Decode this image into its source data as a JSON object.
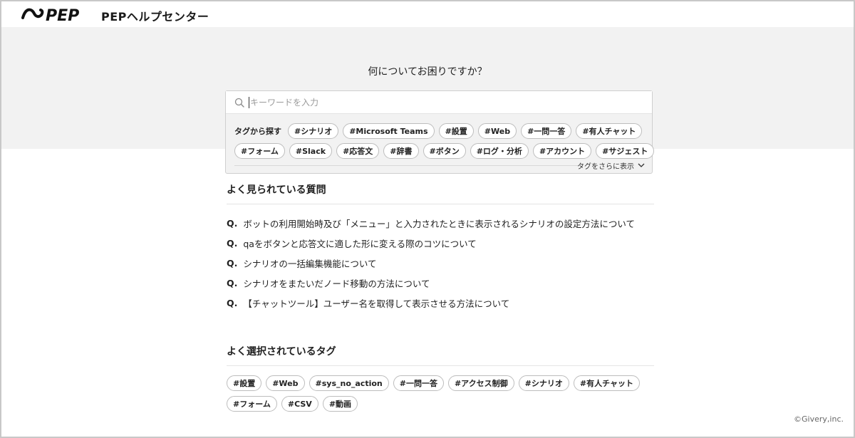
{
  "header": {
    "logo_text": "PEP",
    "brand": "PEPヘルプセンター"
  },
  "hero": {
    "title": "何についてお困りですか？"
  },
  "search": {
    "icon": "search-icon",
    "placeholder": "キーワードを入力",
    "value": ""
  },
  "tag_search": {
    "label": "タグから探す",
    "tags_row1": [
      "#シナリオ",
      "#Microsoft Teams",
      "#設置",
      "#Web",
      "#一問一答",
      "#有人チャット"
    ],
    "tags_row2": [
      "#フォーム",
      "#Slack",
      "#応答文",
      "#辞書",
      "#ボタン",
      "#ログ・分析",
      "#アカウント",
      "#サジェスト"
    ],
    "more_label": "タグをさらに表示",
    "more_icon": "chevron-down-icon"
  },
  "faq": {
    "title": "よく見られている質問",
    "q_prefix": "Q.",
    "items": [
      "ボットの利用開始時及び「メニュー」と入力されたときに表示されるシナリオの設定方法について",
      "qaをボタンと応答文に適した形に変える際のコツについて",
      "シナリオの一括編集機能について",
      "シナリオをまたいだノード移動の方法について",
      "【チャットツール】ユーザー名を取得して表示させる方法について"
    ]
  },
  "popular_tags": {
    "title": "よく選択されているタグ",
    "row1": [
      "#設置",
      "#Web",
      "#sys_no_action",
      "#一問一答",
      "#アクセス制御",
      "#シナリオ",
      "#有人チャット"
    ],
    "row2": [
      "#フォーム",
      "#CSV",
      "#動画"
    ]
  },
  "footer": {
    "copyright": "©Givery,inc."
  }
}
